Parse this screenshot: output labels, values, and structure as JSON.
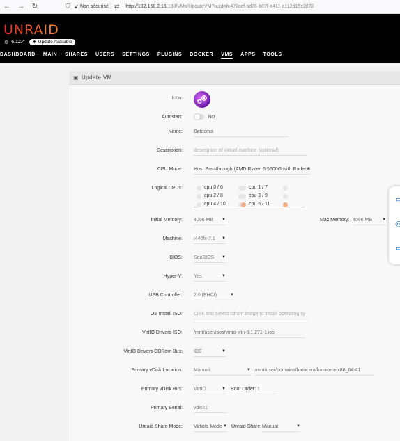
{
  "browser": {
    "security_label": "Non sécurisé",
    "url_host": "http://192.168.2.15",
    "url_rest": ":180/VMs/UpdateVM?uuid=fe478ccf-ad76-b87f-e411-a112d15c3872"
  },
  "header": {
    "logo": "UNRAID",
    "version": "6.12.4",
    "update_label": "Update Available",
    "tabs": [
      "DASHBOARD",
      "MAIN",
      "SHARES",
      "USERS",
      "SETTINGS",
      "PLUGINS",
      "DOCKER",
      "VMS",
      "APPS",
      "TOOLS"
    ],
    "active_tab": "VMS"
  },
  "page": {
    "title": "Update VM"
  },
  "form": {
    "icon_label": "Icon:",
    "autostart_label": "Autostart:",
    "autostart_value": "NO",
    "name_label": "Name:",
    "name_value": "Batocera",
    "description_label": "Description:",
    "description_placeholder": "description of virtual machine (optional)",
    "cpu_mode_label": "CPU Mode:",
    "cpu_mode_value": "Host Passthrough (AMD Ryzen 5 5600G with Radeon",
    "logical_cpus_label": "Logical CPUs:",
    "cpus": [
      {
        "label": "cpu 0 / 6",
        "left": false,
        "right": false
      },
      {
        "label": "cpu 1 / 7",
        "left": false,
        "right": false
      },
      {
        "label": "cpu 2 / 8",
        "left": false,
        "right": false
      },
      {
        "label": "cpu 3 / 9",
        "left": false,
        "right": false
      },
      {
        "label": "cpu 4 / 10",
        "left": false,
        "right": false
      },
      {
        "label": "cpu 5 / 11",
        "left": true,
        "right": true
      }
    ],
    "initial_memory_label": "Initial Memory:",
    "initial_memory_value": "4096 MB",
    "max_memory_label": "Max Memory:",
    "max_memory_value": "4096 MB",
    "machine_label": "Machine:",
    "machine_value": "i440fx-7.1",
    "bios_label": "BIOS:",
    "bios_value": "SeaBIOS",
    "hyperv_label": "Hyper-V:",
    "hyperv_value": "Yes",
    "usb_label": "USB Controller:",
    "usb_value": "2.0 (EHCI)",
    "os_iso_label": "OS Install ISO:",
    "os_iso_placeholder": "Click and Select cdrom image to install operating sy",
    "virtio_iso_label": "VirtIO Drivers ISO:",
    "virtio_iso_value": "/mnt/user/isos/virtio-win-0.1.271-1.iso",
    "virtio_bus_label": "VirtIO Drivers CDRom Bus:",
    "virtio_bus_value": "IDE",
    "vdisk_location_label": "Primary vDisk Location:",
    "vdisk_location_value": "Manual",
    "vdisk_path": "/mnt/user/domains/batocera/batocera-x86_64-41",
    "vdisk_bus_label": "Primary vDisk Bus:",
    "vdisk_bus_value": "VirtIO",
    "boot_order_label": "Boot Order:",
    "boot_order_value": "1",
    "serial_label": "Primary Serial:",
    "serial_value": "vdisk1",
    "share_mode_label": "Unraid Share Mode:",
    "share_mode_value": "Virtiofs Mode",
    "share_label": "Unraid Share:",
    "share_value": "Manual"
  },
  "colors": {
    "logo_start": "#e22828",
    "logo_end": "#ff8c2f",
    "cpu_selected": "#f2ae84",
    "cpu_unselected": "#e6e6e6",
    "float_icon": "#1a73c4"
  },
  "icons": [
    "back-arrow-icon",
    "forward-arrow-icon",
    "reload-icon",
    "shield-icon",
    "lock-icon",
    "permissions-icon",
    "update-star-icon",
    "vm-page-icon",
    "steam-icon",
    "chat-icon",
    "help-icon",
    "feedback-icon"
  ]
}
